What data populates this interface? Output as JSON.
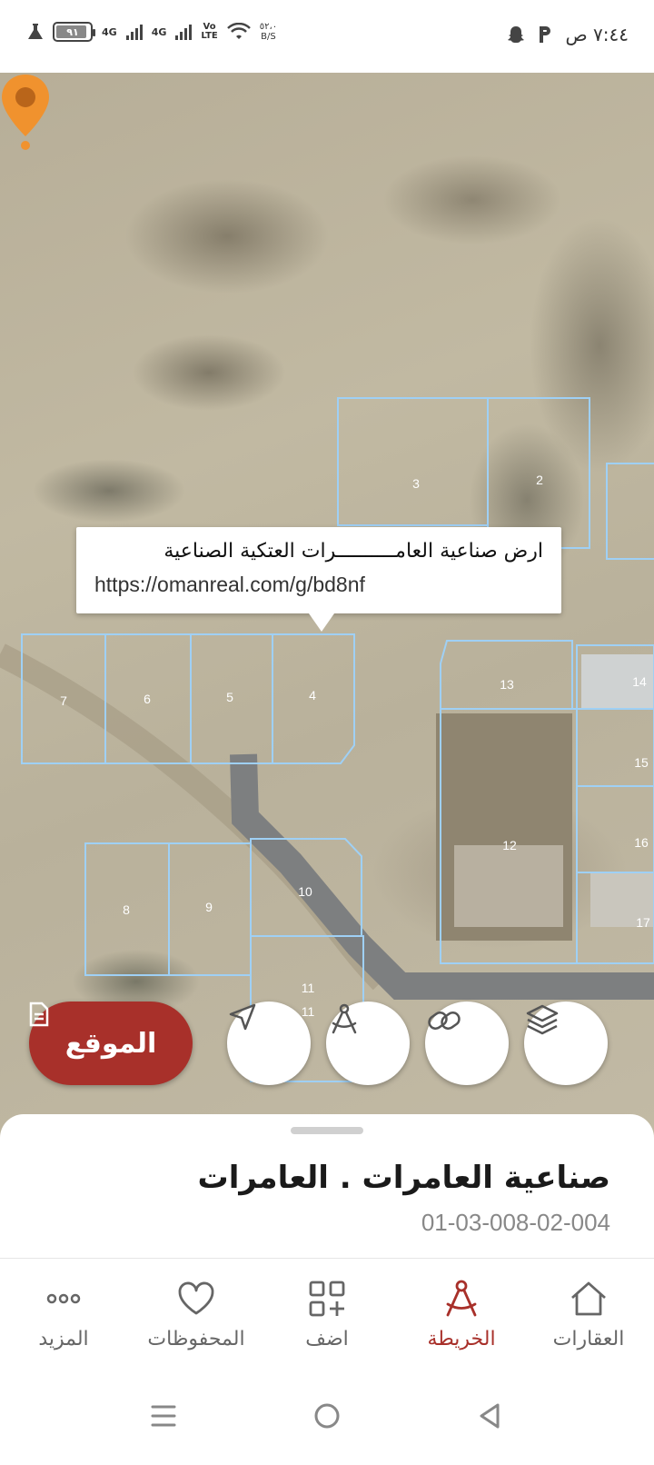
{
  "status_bar": {
    "time": "٧:٤٤ ص",
    "battery": "٩١",
    "battery_level": 0.91,
    "network1": "4G",
    "network2": "4G",
    "volte_top": "Vo",
    "volte_bottom": "LTE",
    "speed_value": "٥٢،٠",
    "speed_unit": "B/S",
    "icons": [
      "lab-flask-icon",
      "signal-icon",
      "wifi-icon",
      "snapchat-ghost-icon",
      "p-app-icon"
    ]
  },
  "map": {
    "popup_title": "ارض صناعية العامــــــــــرات العتكية الصناعية",
    "popup_url": "https://omanreal.com/g/bd8nf",
    "plot_labels": [
      "2",
      "3",
      "4",
      "5",
      "6",
      "7",
      "8",
      "9",
      "10",
      "11",
      "11",
      "12",
      "13",
      "14",
      "15",
      "16",
      "17"
    ],
    "pin_color": "#f0922e"
  },
  "map_buttons": {
    "location_label": "الموقع",
    "accent": "#a8302a"
  },
  "sheet": {
    "title": "صناعية العامرات . العامرات",
    "code": "01-03-008-02-004"
  },
  "nav": {
    "items": [
      {
        "label": "العقارات",
        "icon": "home-icon"
      },
      {
        "label": "الخريطة",
        "icon": "map-compass-icon"
      },
      {
        "label": "اضف",
        "icon": "add-grid-icon"
      },
      {
        "label": "المحفوظات",
        "icon": "heart-icon"
      },
      {
        "label": "المزيد",
        "icon": "more-dots-icon"
      }
    ],
    "active_index": 1
  }
}
